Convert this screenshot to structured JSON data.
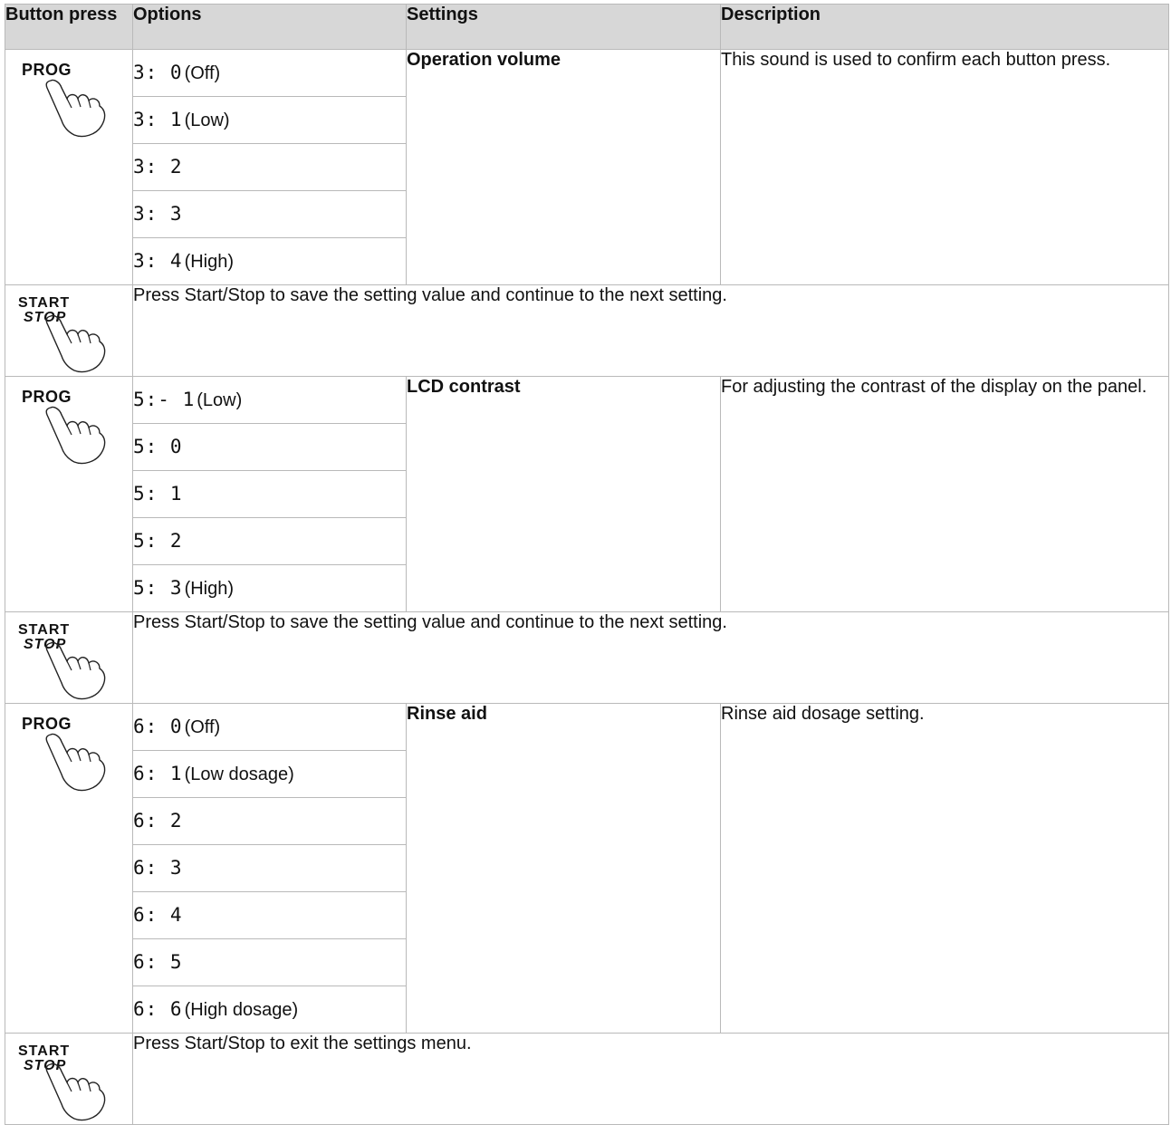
{
  "headers": [
    "Button press",
    "Options",
    "Settings",
    "Description"
  ],
  "buttons": {
    "prog": "PROG",
    "start_top": "START",
    "start_bottom": "STOP"
  },
  "groups": [
    {
      "button": "prog",
      "setting": "Operation volume",
      "description": "This sound is used to confirm each button press.",
      "options": [
        {
          "code": "3: 0",
          "label": "(Off)"
        },
        {
          "code": "3:  1",
          "label": "(Low)"
        },
        {
          "code": "3: 2",
          "label": ""
        },
        {
          "code": "3: 3",
          "label": ""
        },
        {
          "code": "3: 4",
          "label": "(High)"
        }
      ]
    },
    {
      "button": "start",
      "instruction": "Press Start/Stop to save the setting value and continue to the next setting."
    },
    {
      "button": "prog",
      "setting": "LCD contrast",
      "description": "For adjusting the contrast of the display on the panel.",
      "options": [
        {
          "code": "5:- 1",
          "label": "(Low)"
        },
        {
          "code": "5: 0",
          "label": ""
        },
        {
          "code": "5:  1",
          "label": ""
        },
        {
          "code": "5: 2",
          "label": ""
        },
        {
          "code": "5: 3",
          "label": "(High)"
        }
      ]
    },
    {
      "button": "start",
      "instruction": "Press Start/Stop to save the setting value and continue to the next setting."
    },
    {
      "button": "prog",
      "setting": "Rinse aid",
      "description": "Rinse aid dosage setting.",
      "options": [
        {
          "code": "6: 0",
          "label": "(Off)"
        },
        {
          "code": "6:  1",
          "label": "(Low dosage)"
        },
        {
          "code": "6: 2",
          "label": ""
        },
        {
          "code": "6: 3",
          "label": ""
        },
        {
          "code": "6: 4",
          "label": ""
        },
        {
          "code": "6: 5",
          "label": ""
        },
        {
          "code": "6: 6",
          "label": "(High dosage)"
        }
      ]
    },
    {
      "button": "start",
      "instruction": "Press Start/Stop to exit the settings menu."
    }
  ]
}
